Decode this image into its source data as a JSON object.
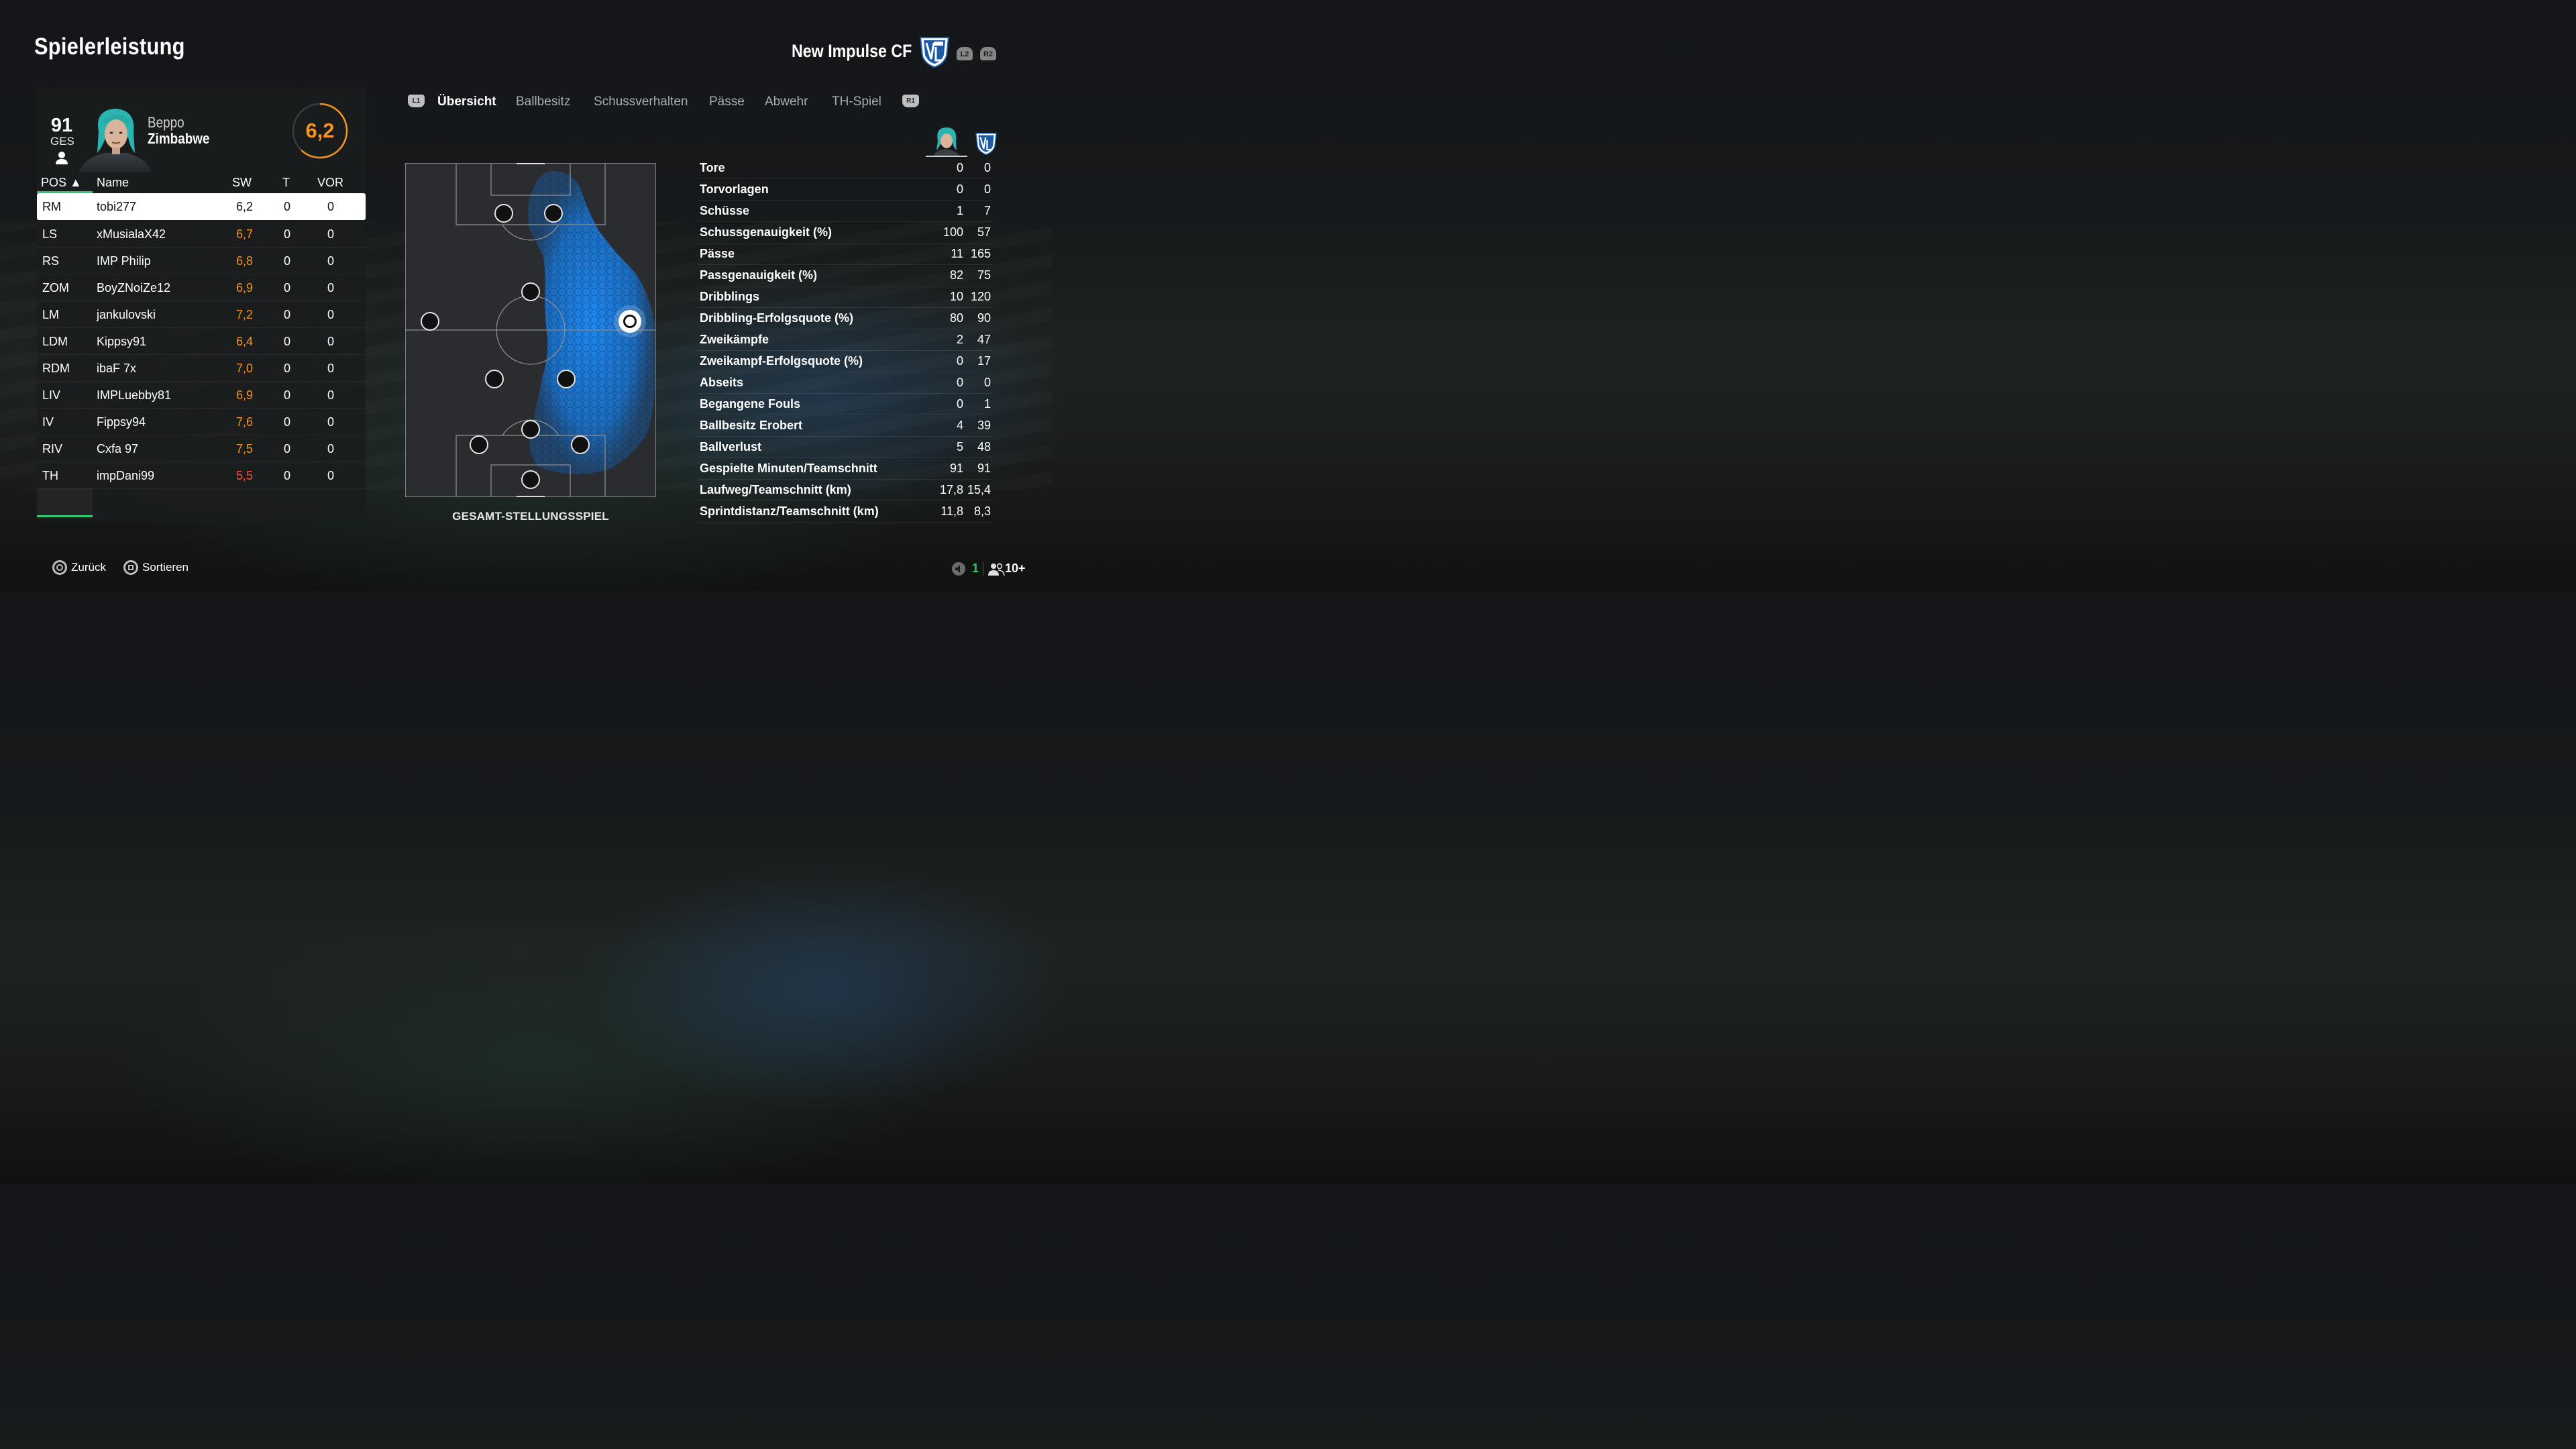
{
  "page": {
    "title": "Spielerleistung"
  },
  "team": {
    "name": "New Impulse CF",
    "l2": "L2",
    "r2": "R2"
  },
  "player": {
    "overall": "91",
    "overall_label": "GES",
    "first_name": "Beppo",
    "last_name": "Zimbabwe",
    "rating": "6,2",
    "rating_color": "#f7941d"
  },
  "table": {
    "headers": {
      "pos": "POS ▲",
      "name": "Name",
      "sw": "SW",
      "t": "T",
      "vor": "VOR"
    },
    "rows": [
      {
        "pos": "RM",
        "name": "tobi277",
        "sw": "6,2",
        "t": "0",
        "vor": "0"
      },
      {
        "pos": "LS",
        "name": "xMusialaX42",
        "sw": "6,7",
        "t": "0",
        "vor": "0"
      },
      {
        "pos": "RS",
        "name": "IMP Philip",
        "sw": "6,8",
        "t": "0",
        "vor": "0"
      },
      {
        "pos": "ZOM",
        "name": "BoyZNoiZe12",
        "sw": "6,9",
        "t": "0",
        "vor": "0"
      },
      {
        "pos": "LM",
        "name": "jankulovski",
        "sw": "7,2",
        "t": "0",
        "vor": "0"
      },
      {
        "pos": "LDM",
        "name": "Kippsy91",
        "sw": "6,4",
        "t": "0",
        "vor": "0"
      },
      {
        "pos": "RDM",
        "name": "ibaF 7x",
        "sw": "7,0",
        "t": "0",
        "vor": "0"
      },
      {
        "pos": "LIV",
        "name": "IMPLuebby81",
        "sw": "6,9",
        "t": "0",
        "vor": "0"
      },
      {
        "pos": "IV",
        "name": "Fippsy94",
        "sw": "7,6",
        "t": "0",
        "vor": "0"
      },
      {
        "pos": "RIV",
        "name": "Cxfa 97",
        "sw": "7,5",
        "t": "0",
        "vor": "0"
      },
      {
        "pos": "TH",
        "name": "impDani99",
        "sw": "5,5",
        "t": "0",
        "vor": "0"
      }
    ],
    "colors": {
      "rating_orange": "#f7941d",
      "rating_red": "#ff4b3a",
      "accent_green": "#2ecc71"
    }
  },
  "tabs": {
    "l1": "L1",
    "r1": "R1",
    "items": [
      "Übersicht",
      "Ballbesitz",
      "Schussverhalten",
      "Pässe",
      "Abwehr",
      "TH-Spiel"
    ],
    "active": "Übersicht"
  },
  "pitch": {
    "label": "GESAMT-STELLUNGSSPIEL",
    "heat_color": "#1e90ff"
  },
  "stats": {
    "rows": [
      {
        "label": "Tore",
        "player": "0",
        "team": "0"
      },
      {
        "label": "Torvorlagen",
        "player": "0",
        "team": "0"
      },
      {
        "label": "Schüsse",
        "player": "1",
        "team": "7"
      },
      {
        "label": "Schussgenauigkeit (%)",
        "player": "100",
        "team": "57"
      },
      {
        "label": "Pässe",
        "player": "11",
        "team": "165"
      },
      {
        "label": "Passgenauigkeit (%)",
        "player": "82",
        "team": "75"
      },
      {
        "label": "Dribblings",
        "player": "10",
        "team": "120"
      },
      {
        "label": "Dribbling-Erfolgsquote (%)",
        "player": "80",
        "team": "90"
      },
      {
        "label": "Zweikämpfe",
        "player": "2",
        "team": "47"
      },
      {
        "label": "Zweikampf-Erfolgsquote (%)",
        "player": "0",
        "team": "17"
      },
      {
        "label": "Abseits",
        "player": "0",
        "team": "0"
      },
      {
        "label": "Begangene Fouls",
        "player": "0",
        "team": "1"
      },
      {
        "label": "Ballbesitz Erobert",
        "player": "4",
        "team": "39"
      },
      {
        "label": "Ballverlust",
        "player": "5",
        "team": "48"
      },
      {
        "label": "Gespielte Minuten/Teamschnitt",
        "player": "91",
        "team": "91"
      },
      {
        "label": "Laufweg/Teamschnitt (km)",
        "player": "17,8",
        "team": "15,4"
      },
      {
        "label": "Sprintdistanz/Teamschnitt (km)",
        "player": "11,8",
        "team": "8,3"
      }
    ]
  },
  "footer": {
    "back": "Zurück",
    "sort": "Sortieren",
    "online_count": "1",
    "players_count": "10+"
  }
}
